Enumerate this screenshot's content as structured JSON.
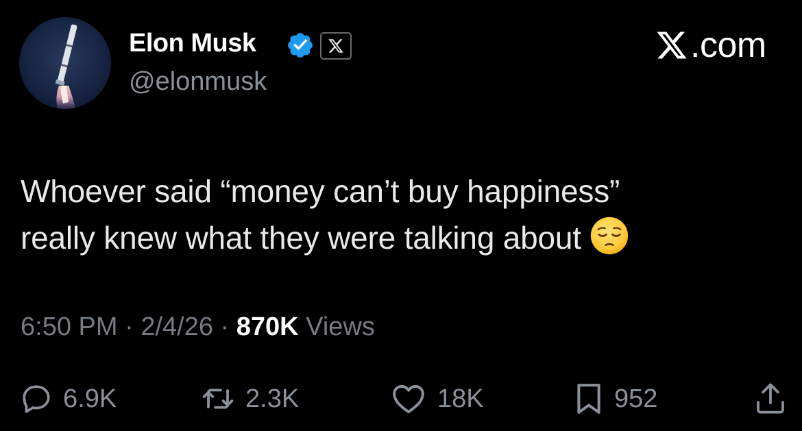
{
  "author": {
    "display_name": "Elon Musk",
    "handle": "@elonmusk",
    "avatar": "rocket-launch-avatar",
    "verified": true,
    "affiliation_badge": "x-logo-badge"
  },
  "brand": {
    "logo_text": ".com",
    "logo_icon": "x-logo-icon"
  },
  "tweet": {
    "line1": "Whoever said “money can’t buy happiness”",
    "line2": "really knew what they were talking about",
    "emoji": "pensive-face-emoji"
  },
  "meta": {
    "time": "6:50 PM",
    "separator": "·",
    "date": "2/4/26",
    "views_count": "870K",
    "views_label": "Views"
  },
  "actions": {
    "replies": "6.9K",
    "reposts": "2.3K",
    "likes": "18K",
    "bookmarks": "952"
  },
  "colors": {
    "background": "#000000",
    "primary_text": "#e7e9ea",
    "secondary_text": "#8b9199",
    "verified_blue": "#1d9bf0"
  }
}
